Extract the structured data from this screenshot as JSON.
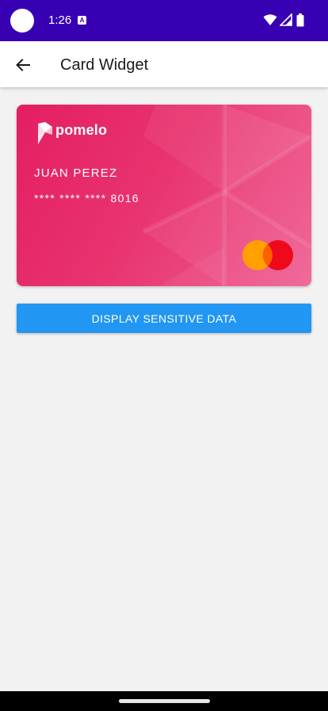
{
  "status_bar": {
    "time": "1:26",
    "notification_icon_letter": "A",
    "icons": [
      "wifi-icon",
      "signal-icon",
      "battery-icon"
    ]
  },
  "app_bar": {
    "title": "Card Widget",
    "back_icon": "arrow-back-icon"
  },
  "card": {
    "brand_name": "pomelo",
    "holder_name": "JUAN PEREZ",
    "number_masked": "**** **** **** 8016",
    "network_logo": "mastercard-logo",
    "colors": {
      "gradient_start": "#e41e63",
      "gradient_end": "#ef5f93"
    }
  },
  "actions": {
    "display_button_label": "DISPLAY SENSITIVE DATA"
  },
  "theme": {
    "status_bar_color": "#3700b3",
    "button_color": "#2196f3",
    "background": "#f2f2f2"
  }
}
